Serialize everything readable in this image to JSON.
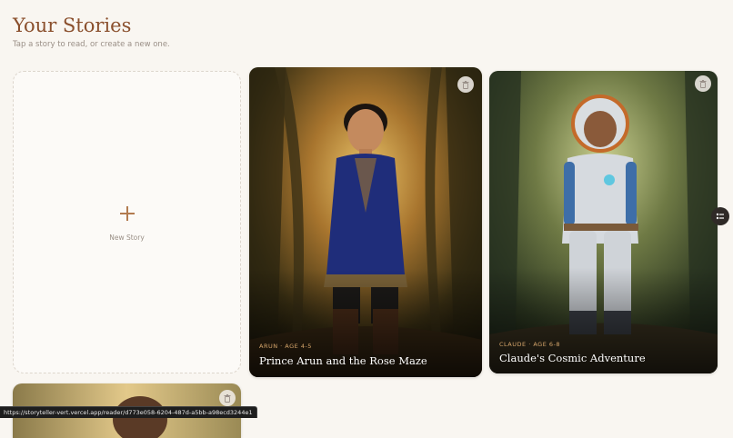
{
  "header": {
    "title": "Your Stories",
    "subtitle": "Tap a story to read, or create a new one."
  },
  "new_story": {
    "label": "New Story",
    "icon": "plus-icon"
  },
  "stories": [
    {
      "meta": "ARUN · AGE 4-5",
      "title": "Prince Arun and the Rose Maze",
      "delete_icon": "trash-icon"
    },
    {
      "meta": "CLAUDE · AGE 6-8",
      "title": "Claude's Cosmic Adventure",
      "delete_icon": "trash-icon"
    },
    {
      "delete_icon": "trash-icon"
    }
  ],
  "side_toggle_icon": "list-toggle-icon",
  "status_bar": {
    "url": "https://storyteller-vert.vercel.app/reader/d773e058-6204-487d-a5bb-a98ecd3244e1"
  },
  "colors": {
    "background": "#f9f6f1",
    "title": "#8a4f2c",
    "accent": "#b27b4f",
    "meta": "#d6a66b"
  }
}
